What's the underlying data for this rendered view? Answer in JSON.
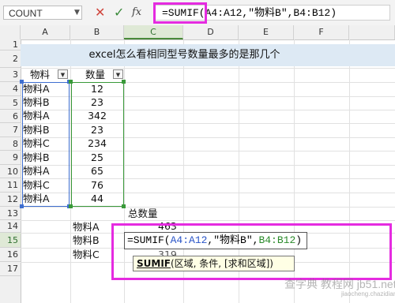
{
  "formula_bar": {
    "name_box": "COUNT",
    "formula": "=SUMIF(A4:A12,\"物料B\",B4:B12)",
    "cancel_glyph": "✕",
    "enter_glyph": "✓",
    "fx_label": "fx"
  },
  "columns": [
    "A",
    "B",
    "C",
    "D",
    "E",
    "F"
  ],
  "selected_column": "C",
  "rows": [
    "1",
    "2",
    "3",
    "4",
    "5",
    "6",
    "7",
    "8",
    "9",
    "10",
    "11",
    "12",
    "13",
    "14",
    "15",
    "16",
    "17"
  ],
  "selected_row": "15",
  "sheet": {
    "title": "excel怎么看相同型号数量最多的是那几个",
    "header_a": "物料",
    "header_b": "数量",
    "data_rows": [
      {
        "item": "物料A",
        "qty": "12"
      },
      {
        "item": "物料B",
        "qty": "23"
      },
      {
        "item": "物料A",
        "qty": "342"
      },
      {
        "item": "物料B",
        "qty": "23"
      },
      {
        "item": "物料C",
        "qty": "234"
      },
      {
        "item": "物料B",
        "qty": "25"
      },
      {
        "item": "物料A",
        "qty": "65"
      },
      {
        "item": "物料C",
        "qty": "76"
      },
      {
        "item": "物料A",
        "qty": "44"
      }
    ],
    "summary_header": "总数量",
    "summary": [
      {
        "item": "物料A",
        "total": "463"
      },
      {
        "item": "物料B",
        "total": ""
      },
      {
        "item": "物料C",
        "total": "319"
      }
    ]
  },
  "editing": {
    "prefix": "=SUMIF(",
    "range_a": "A4:A12",
    "middle": ",\"物料B\",",
    "range_b": "B4:B12",
    "suffix": ")"
  },
  "tooltip": {
    "fn": "SUMIF",
    "args": "(区域, 条件, [求和区域])"
  },
  "watermark": {
    "text": "查字典 教程网 jb51.net",
    "sub": "jiaocheng.chazidian.com"
  },
  "colors": {
    "highlight": "#e52be0",
    "range_a": "#3f6fd0",
    "range_b": "#3a9a3a",
    "title_fill": "#dde9f4"
  }
}
